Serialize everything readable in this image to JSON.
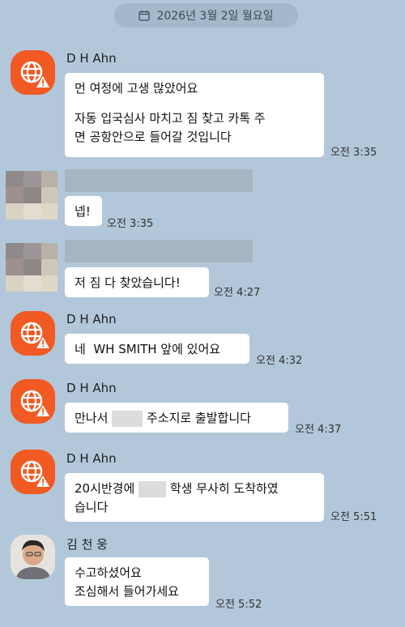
{
  "date_divider": "2026년 3월 2일 월요일",
  "messages": [
    {
      "sender": "D H Ahn",
      "lines": [
        "먼 여정에 고생 많았어요",
        "",
        "자동 입국심사 마치고 짐 찾고 카톡 주",
        "면 공항안으로 들어갈 것입니다"
      ],
      "time": "오전 3:35"
    },
    {
      "sender": "",
      "lines": [
        "넵!"
      ],
      "time": "오전 3:35"
    },
    {
      "sender": "",
      "lines": [
        "저 짐 다 찾았습니다!"
      ],
      "time": "오전 4:27"
    },
    {
      "sender": "D H Ahn",
      "lines": [
        "네  WH SMITH 앞에 있어요"
      ],
      "time": "오전 4:32"
    },
    {
      "sender": "D H Ahn",
      "line_a": "만나서",
      "line_b": "주소지로 출발합니다",
      "time": "오전 4:37"
    },
    {
      "sender": "D H Ahn",
      "line_a": "20시반경에",
      "line_b": "학생 무사히 도착하였",
      "line_c": "습니다",
      "time": "오전 5:51"
    },
    {
      "sender": "김 천 웅",
      "lines": [
        "수고하셨어요",
        "조심해서 들어가세요"
      ],
      "time": "오전 5:52"
    }
  ]
}
